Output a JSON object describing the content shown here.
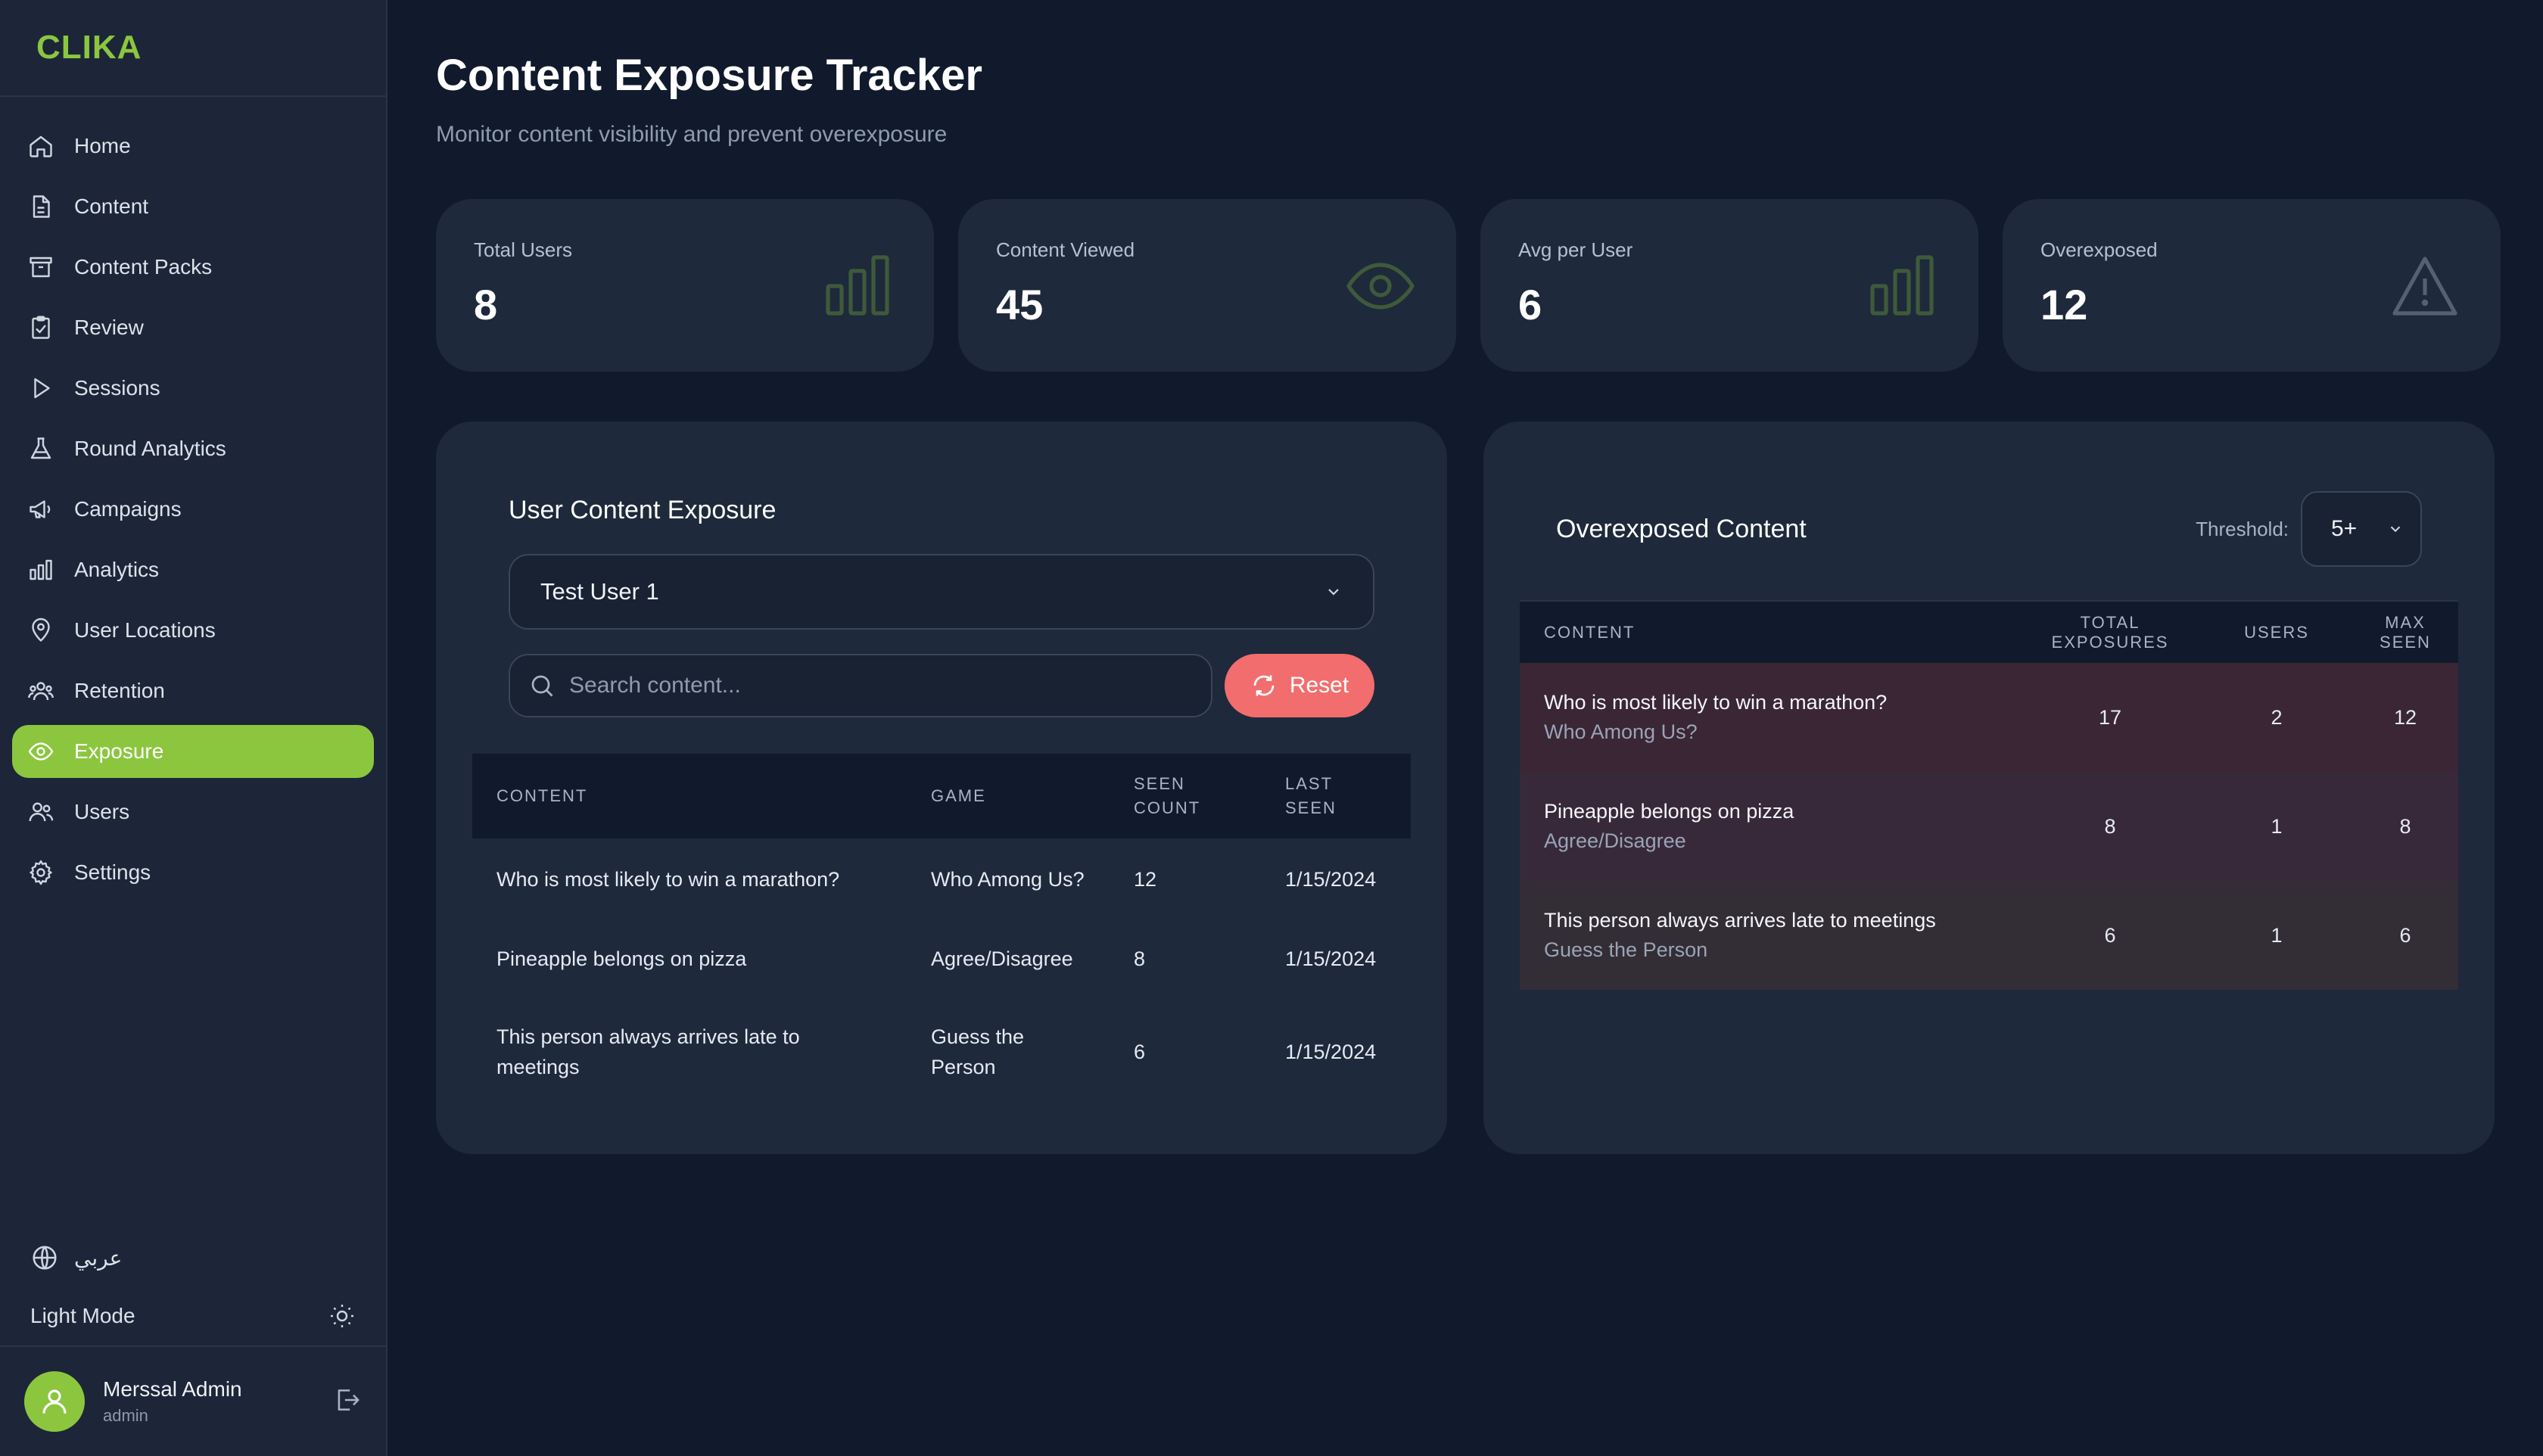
{
  "brand": "CLIKA",
  "sidebar": {
    "items": [
      {
        "label": "Home",
        "icon": "home-icon"
      },
      {
        "label": "Content",
        "icon": "document-icon"
      },
      {
        "label": "Content Packs",
        "icon": "archive-icon"
      },
      {
        "label": "Review",
        "icon": "clipboard-icon"
      },
      {
        "label": "Sessions",
        "icon": "play-icon"
      },
      {
        "label": "Round Analytics",
        "icon": "flask-icon"
      },
      {
        "label": "Campaigns",
        "icon": "megaphone-icon"
      },
      {
        "label": "Analytics",
        "icon": "bar-chart-icon"
      },
      {
        "label": "User Locations",
        "icon": "map-pin-icon"
      },
      {
        "label": "Retention",
        "icon": "users-group-icon"
      },
      {
        "label": "Exposure",
        "icon": "eye-icon",
        "active": true
      },
      {
        "label": "Users",
        "icon": "users-icon"
      },
      {
        "label": "Settings",
        "icon": "gear-icon"
      }
    ],
    "language": "عربي",
    "theme_label": "Light Mode",
    "user": {
      "name": "Merssal Admin",
      "role": "admin"
    }
  },
  "header": {
    "title": "Content Exposure Tracker",
    "subtitle": "Monitor content visibility and prevent overexposure"
  },
  "stats": [
    {
      "label": "Total Users",
      "value": "8",
      "icon": "bar-chart-icon"
    },
    {
      "label": "Content Viewed",
      "value": "45",
      "icon": "eye-icon"
    },
    {
      "label": "Avg per User",
      "value": "6",
      "icon": "bar-chart-icon"
    },
    {
      "label": "Overexposed",
      "value": "12",
      "icon": "warning-icon"
    }
  ],
  "user_exposure": {
    "title": "User Content Exposure",
    "selected_user": "Test User 1",
    "search_placeholder": "Search content...",
    "reset_label": "Reset",
    "columns": [
      "CONTENT",
      "GAME",
      "SEEN COUNT",
      "LAST SEEN"
    ],
    "rows": [
      {
        "content": "Who is most likely to win a marathon?",
        "game": "Who Among Us?",
        "seen_count": "12",
        "last_seen": "1/15/2024"
      },
      {
        "content": "Pineapple belongs on pizza",
        "game": "Agree/Disagree",
        "seen_count": "8",
        "last_seen": "1/15/2024"
      },
      {
        "content": "This person always arrives late to meetings",
        "game": "Guess the Person",
        "seen_count": "6",
        "last_seen": "1/15/2024"
      }
    ]
  },
  "overexposed": {
    "title": "Overexposed Content",
    "threshold_label": "Threshold:",
    "threshold_value": "5+",
    "columns": [
      "CONTENT",
      "TOTAL EXPOSURES",
      "USERS",
      "MAX SEEN"
    ],
    "rows": [
      {
        "content": "Who is most likely to win a marathon?",
        "game": "Who Among Us?",
        "total": "17",
        "users": "2",
        "max_seen": "12"
      },
      {
        "content": "Pineapple belongs on pizza",
        "game": "Agree/Disagree",
        "total": "8",
        "users": "1",
        "max_seen": "8"
      },
      {
        "content": "This person always arrives late to meetings",
        "game": "Guess the Person",
        "total": "6",
        "users": "1",
        "max_seen": "6"
      }
    ]
  },
  "colors": {
    "accent": "#8cc63f",
    "danger": "#f26d6d",
    "warning": "#f39a4a",
    "caution": "#e9c34a",
    "background": "#111a2c",
    "card": "#1e293b"
  }
}
